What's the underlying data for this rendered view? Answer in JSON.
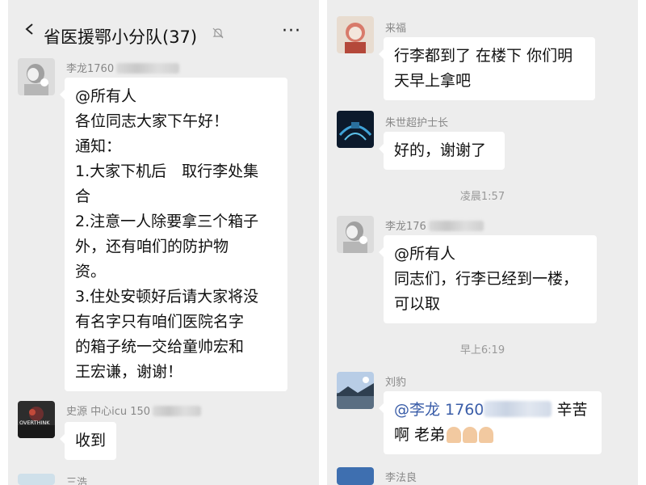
{
  "left": {
    "header": {
      "back_icon": "chevron-left-icon",
      "title": "省医援鄂小分队(37)",
      "mute_icon": "bell-off-icon",
      "more_icon": "ellipsis-icon",
      "more_label": "···"
    },
    "messages": [
      {
        "sender": "李龙1760",
        "lines": [
          "@所有人",
          "各位同志大家下午好！",
          "通知：",
          "1.大家下机后　取行李处集",
          "合",
          "2.注意一人除要拿三个箱子",
          "外，还有咱们的防护物",
          "资。",
          "3.住处安顿好后请大家将没",
          "有名字只有咱们医院名字",
          "的箱子统一交给童帅宏和",
          "王宏谦，谢谢！"
        ]
      },
      {
        "sender": "史源 中心icu 150",
        "avatar_text": "OVERTHINK",
        "text": "收到"
      },
      {
        "sender": "三浩"
      }
    ]
  },
  "right": {
    "messages": [
      {
        "sender": "来福",
        "lines": [
          "行李都到了 在楼下 你们明",
          "天早上拿吧"
        ]
      },
      {
        "sender": "朱世超护士长",
        "text": "好的，谢谢了"
      },
      {
        "time": "凌晨1:57"
      },
      {
        "sender": "李龙176",
        "lines": [
          "@所有人",
          "同志们，行李已经到一楼，",
          "可以取"
        ]
      },
      {
        "time": "早上6:19"
      },
      {
        "sender": "刘豹",
        "line1_prefix": "@李龙 ",
        "line1_number": "1760",
        "line1_suffix": " 辛苦",
        "line2": "啊 老弟",
        "emoji_icon": "folded-hands-icon"
      },
      {
        "sender": "李法良"
      }
    ]
  }
}
